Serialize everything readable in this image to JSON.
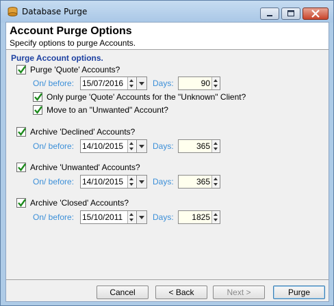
{
  "window": {
    "title": "Database Purge"
  },
  "header": {
    "title": "Account Purge Options",
    "subtitle": "Specify options to purge Accounts."
  },
  "section": {
    "title": "Purge Account options."
  },
  "groups": [
    {
      "label": "Purge 'Quote' Accounts?",
      "checked": true,
      "on_before_label": "On/ before:",
      "date": "15/07/2016",
      "days_label": "Days:",
      "days": "90",
      "sub_options": [
        {
          "label": "Only purge 'Quote' Accounts for the \"Unknown\" Client?",
          "checked": true
        },
        {
          "label": "Move to an \"Unwanted\" Account?",
          "checked": true
        }
      ]
    },
    {
      "label": "Archive 'Declined' Accounts?",
      "checked": true,
      "on_before_label": "On/ before:",
      "date": "14/10/2015",
      "days_label": "Days:",
      "days": "365"
    },
    {
      "label": "Archive 'Unwanted' Accounts?",
      "checked": true,
      "on_before_label": "On/ before:",
      "date": "14/10/2015",
      "days_label": "Days:",
      "days": "365"
    },
    {
      "label": "Archive 'Closed' Accounts?",
      "checked": true,
      "on_before_label": "On/ before:",
      "date": "15/10/2011",
      "days_label": "Days:",
      "days": "1825"
    }
  ],
  "buttons": {
    "cancel": "Cancel",
    "back": "< Back",
    "next": "Next >",
    "purge": "Purge"
  },
  "colors": {
    "title_bar": "#aecbe7",
    "section_title": "#1b3fa0",
    "field_label": "#3b8fd8",
    "check": "#1c8a1c",
    "days_field_bg": "#ffffee"
  }
}
